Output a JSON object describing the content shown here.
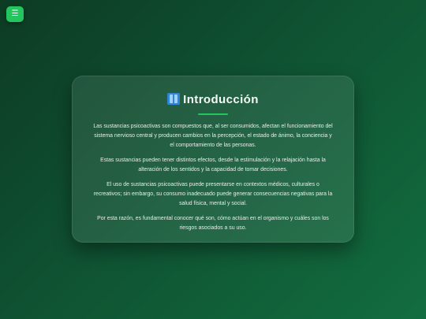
{
  "menu": {
    "icon_glyph": "☰"
  },
  "intro": {
    "title": "Introducción",
    "paragraphs": [
      "Las sustancias psicoactivas son compuestos que, al ser consumidos, afectan el funcionamiento del sistema nervioso central y producen cambios en la percepción, el estado de ánimo, la conciencia y el comportamiento de las personas.",
      "Estas sustancias pueden tener distintos efectos, desde la estimulación y la relajación hasta la alteración de los sentidos y la capacidad de tomar decisiones.",
      "El uso de sustancias psicoactivas puede presentarse en contextos médicos, culturales o recreativos; sin embargo, su consumo inadecuado puede generar consecuencias negativas para la salud física, mental y social.",
      "Por esta razón, es fundamental conocer qué son, cómo actúan en el organismo y cuáles son los riesgos asociados a su uso."
    ]
  },
  "colors": {
    "accent": "#22c55e",
    "background_start": "#0d3b24",
    "background_end": "#126d3f"
  },
  "icons": {
    "menu": "hamburger-menu-icon",
    "title": "book-icon"
  }
}
